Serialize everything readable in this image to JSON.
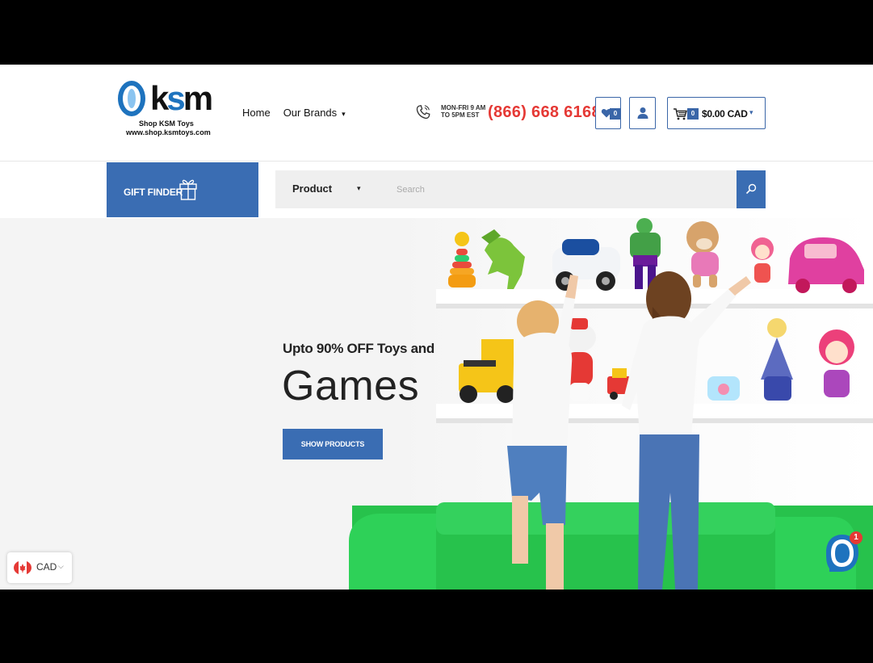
{
  "logo": {
    "word_k": "k",
    "word_s": "s",
    "word_m": "m",
    "tagline": "Shop KSM Toys",
    "url": "www.shop.ksmtoys.com"
  },
  "nav": {
    "home": "Home",
    "brands": "Our Brands"
  },
  "contact": {
    "hours": "MON-FRI 9 AM TO 5PM EST",
    "phone": "(866) 668 6168"
  },
  "header_actions": {
    "wishlist_count": "0",
    "cart_count": "0",
    "cart_total": "$0.00 CAD"
  },
  "gift_finder": {
    "label": "GIFT FINDER"
  },
  "search": {
    "category": "Product",
    "placeholder": "Search"
  },
  "hero": {
    "subtitle": "Upto 90% OFF Toys and",
    "title": "Games",
    "button": "SHOW PRODUCTS"
  },
  "currency": {
    "code": "CAD"
  },
  "chat": {
    "badge": "1"
  },
  "colors": {
    "brand_blue": "#3a6db3",
    "phone_red": "#e53935",
    "sofa_green": "#27c24c"
  },
  "icons": [
    "phone-icon",
    "heart-icon",
    "user-icon",
    "cart-icon",
    "gift-icon",
    "search-icon",
    "flag-icon",
    "chat-icon",
    "chevron-down-icon"
  ]
}
